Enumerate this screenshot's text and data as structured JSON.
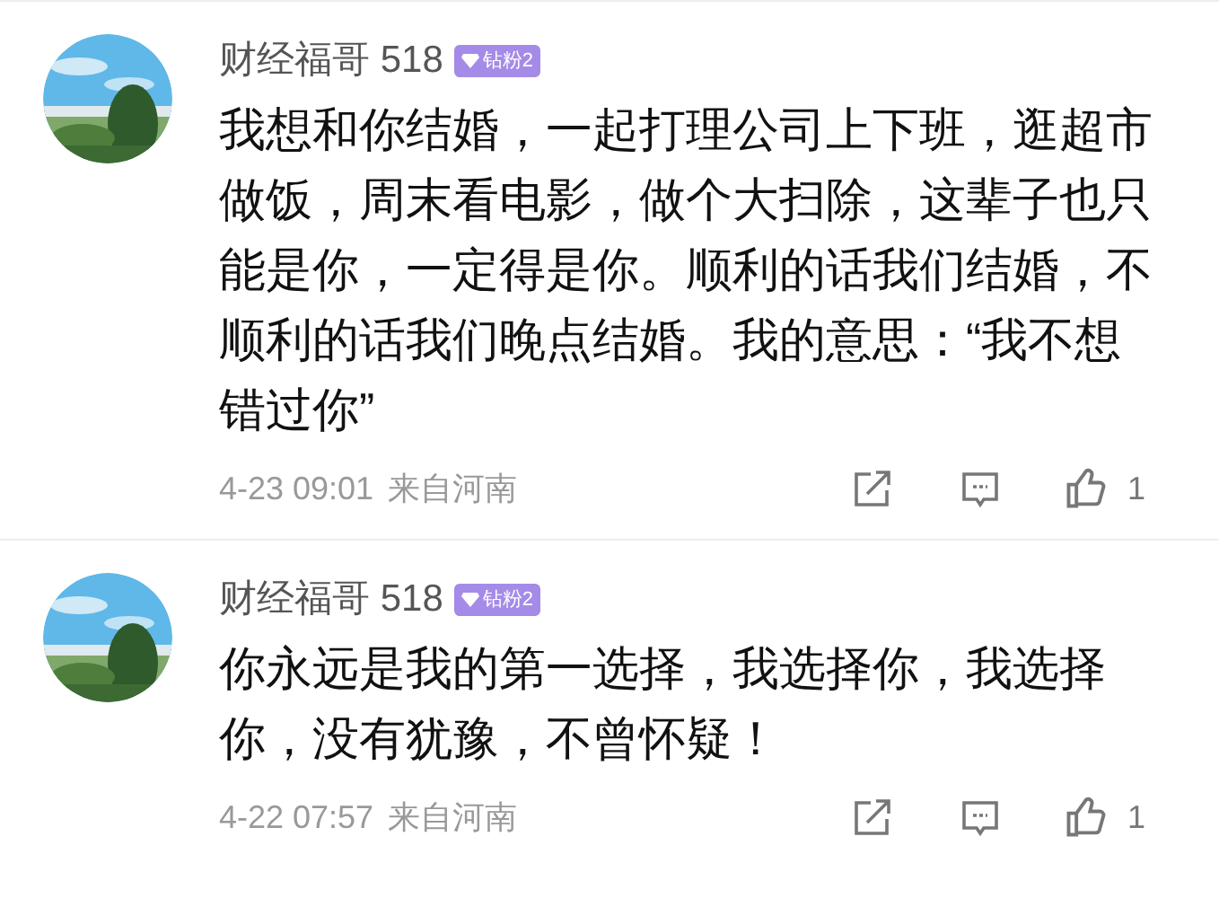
{
  "comments": [
    {
      "author": "财经福哥 518",
      "badge": "钻粉2",
      "text": "我想和你结婚，一起打理公司上下班，逛超市做饭，周末看电影，做个大扫除，这辈子也只能是你，一定得是你。顺利的话我们结婚，不顺利的话我们晚点结婚。我的意思：“我不想错过你”",
      "time": "4-23 09:01",
      "location": "来自河南",
      "likes": "1"
    },
    {
      "author": "财经福哥 518",
      "badge": "钻粉2",
      "text": "你永远是我的第一选择，我选择你，我选择你，没有犹豫，不曾怀疑！",
      "time": "4-22 07:57",
      "location": "来自河南",
      "likes": "1"
    }
  ]
}
